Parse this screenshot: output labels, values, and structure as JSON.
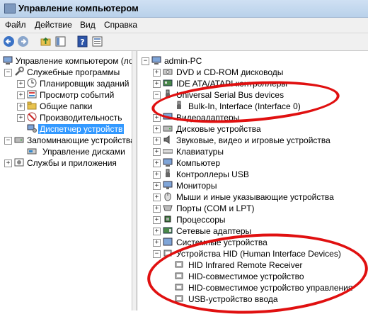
{
  "window": {
    "title": "Управление компьютером"
  },
  "menu": {
    "file": "Файл",
    "action": "Действие",
    "view": "Вид",
    "help": "Справка"
  },
  "left_tree": {
    "root": "Управление компьютером (лока",
    "system_tools": "Служебные программы",
    "task_scheduler": "Планировщик заданий",
    "event_viewer": "Просмотр событий",
    "shared_folders": "Общие папки",
    "performance": "Производительность",
    "device_manager": "Диспетчер устройств",
    "storage": "Запоминающие устройства",
    "disk_management": "Управление дисками",
    "services": "Службы и приложения"
  },
  "right_tree": {
    "root": "admin-PC",
    "dvd": "DVD и CD-ROM дисководы",
    "ide": "IDE ATA/ATAPI контроллеры",
    "usb_devices": "Universal Serial Bus devices",
    "bulk_in": "Bulk-In, Interface (Interface 0)",
    "video": "Видеоадаптеры",
    "disks": "Дисковые устройства",
    "sound": "Звуковые, видео и игровые устройства",
    "keyboards": "Клавиатуры",
    "computer": "Компьютер",
    "usb_controllers": "Контроллеры USB",
    "monitors": "Мониторы",
    "mice": "Мыши и иные указывающие устройства",
    "ports": "Порты (COM и LPT)",
    "processors": "Процессоры",
    "network": "Сетевые адаптеры",
    "system": "Системные устройства",
    "hid": "Устройства HID (Human Interface Devices)",
    "hid_ir": "HID Infrared Remote Receiver",
    "hid_compat": "HID-совместимое устройство",
    "hid_control": "HID-совместимое устройство управления",
    "usb_input": "USB-устройство ввода"
  },
  "colors": {
    "annotation": "#e01010",
    "selection": "#3399ff"
  }
}
